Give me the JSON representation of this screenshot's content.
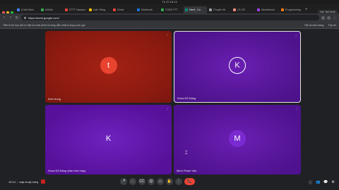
{
  "menubar": {
    "clock": "Th 22 18:14"
  },
  "traffic": {
    "close_color": "#ff5f57",
    "min_color": "#febc2e",
    "max_color": "#28c840"
  },
  "tabs": [
    {
      "label": "(Call) Meet",
      "active": false,
      "color": "#4285f4"
    },
    {
      "label": "AIWeb",
      "active": false,
      "color": "#34a853"
    },
    {
      "label": "ZTTT Campus",
      "active": false,
      "color": "#ea4335"
    },
    {
      "label": "Auth Tiếng",
      "active": false,
      "color": "#fbbc05"
    },
    {
      "label": "Gmail",
      "active": false,
      "color": "#ea4335"
    },
    {
      "label": "Workbook",
      "active": false,
      "color": "#1a73e8"
    },
    {
      "label": "TODO FTT",
      "active": false,
      "color": "#34a853"
    },
    {
      "label": "Meet - Ca",
      "active": true,
      "color": "#00897b"
    },
    {
      "label": "Chuyên đề",
      "active": false,
      "color": "#9aa0a6"
    },
    {
      "label": "LS CIS",
      "active": false,
      "color": "#f28b82"
    },
    {
      "label": "Sketchbook",
      "active": false,
      "color": "#a142f4"
    },
    {
      "label": "Programming",
      "active": false,
      "color": "#fa7b17"
    }
  ],
  "tabright": {
    "profile": "Các Tab Khác"
  },
  "address": {
    "url": "https://meet.google.com/"
  },
  "bookmarks": {
    "left": "Tiến trình học đã có đặt và chia kênh hướng dẫn chất lượng cuộc gọi",
    "right1": "Tất cả dấu trang",
    "right2": "Tệp tin"
  },
  "tiles": [
    {
      "initial": "t",
      "name": "trinh trung",
      "menu": "⋮"
    },
    {
      "initial": "K",
      "name": "Khoa Đỗ Đăng",
      "menu": "⋮"
    },
    {
      "initial": "K",
      "name": "Khoa Đỗ Đăng (bản trình bày)",
      "menu": "⋮"
    },
    {
      "initial": "M",
      "name": "Minh Phạm Văn",
      "menu": "⋮"
    }
  ],
  "controls": {
    "time": "10:14",
    "meeting_code": "wqe-hvzjt-mwq",
    "buttons": [
      "🎤",
      "🎥",
      "CC",
      "😊",
      "▭",
      "✋",
      "⋮"
    ],
    "end_icon": "📞",
    "right": [
      "ⓘ",
      "👥",
      "💬",
      "⚙"
    ]
  }
}
